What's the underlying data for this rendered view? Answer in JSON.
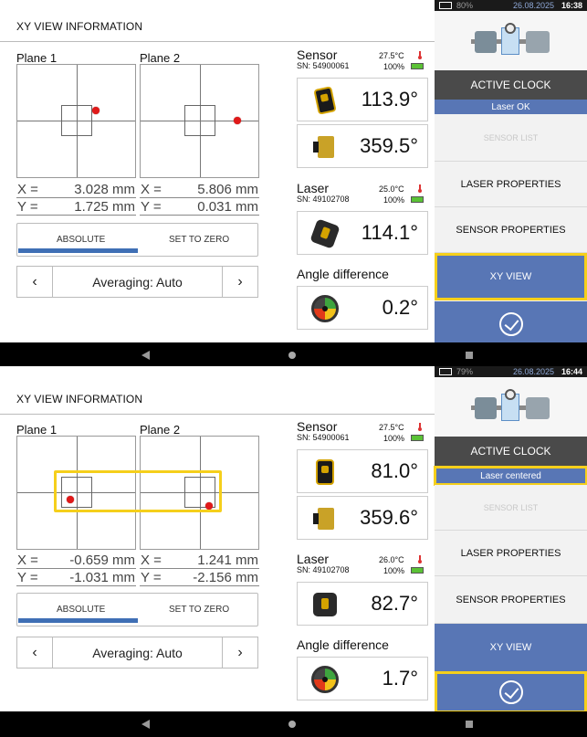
{
  "screens": [
    {
      "title": "XY VIEW INFORMATION",
      "plane1": {
        "label": "Plane 1",
        "x_key": "X =",
        "x_val": "3.028 mm",
        "y_key": "Y =",
        "y_val": "1.725 mm"
      },
      "plane2": {
        "label": "Plane 2",
        "x_key": "X =",
        "x_val": "5.806 mm",
        "y_key": "Y =",
        "y_val": "0.031 mm"
      },
      "mode": {
        "absolute": "ABSOLUTE",
        "set_to_zero": "SET TO ZERO",
        "selected": "ABSOLUTE"
      },
      "averaging": {
        "label": "Averaging: Auto",
        "prev": "‹",
        "next": "›"
      },
      "sensor": {
        "title": "Sensor",
        "sn": "SN: 54900061",
        "temp": "27.5°C",
        "battery": "100%"
      },
      "sensor_reading_1": "113.9°",
      "sensor_reading_2": "359.5°",
      "laser": {
        "title": "Laser",
        "sn": "SN: 49102708",
        "temp": "25.0°C",
        "battery": "100%"
      },
      "laser_reading": "114.1°",
      "angle_difference": {
        "title": "Angle difference",
        "value": "0.2°"
      },
      "status": {
        "battery": "80%",
        "date": "26.08.2025",
        "time": "16:38"
      },
      "menu": {
        "active_clock": "ACTIVE CLOCK",
        "laser_status": "Laser OK",
        "sensor_list": "SENSOR LIST",
        "laser_properties": "LASER PROPERTIES",
        "sensor_properties": "SENSOR PROPERTIES",
        "xy_view": "XY VIEW"
      }
    },
    {
      "title": "XY VIEW INFORMATION",
      "plane1": {
        "label": "Plane 1",
        "x_key": "X =",
        "x_val": "-0.659 mm",
        "y_key": "Y =",
        "y_val": "-1.031 mm"
      },
      "plane2": {
        "label": "Plane 2",
        "x_key": "X =",
        "x_val": "1.241 mm",
        "y_key": "Y =",
        "y_val": "-2.156 mm"
      },
      "mode": {
        "absolute": "ABSOLUTE",
        "set_to_zero": "SET TO ZERO",
        "selected": "ABSOLUTE"
      },
      "averaging": {
        "label": "Averaging: Auto",
        "prev": "‹",
        "next": "›"
      },
      "sensor": {
        "title": "Sensor",
        "sn": "SN: 54900061",
        "temp": "27.5°C",
        "battery": "100%"
      },
      "sensor_reading_1": "81.0°",
      "sensor_reading_2": "359.6°",
      "laser": {
        "title": "Laser",
        "sn": "SN: 49102708",
        "temp": "26.0°C",
        "battery": "100%"
      },
      "laser_reading": "82.7°",
      "angle_difference": {
        "title": "Angle difference",
        "value": "1.7°"
      },
      "status": {
        "battery": "79%",
        "date": "26.08.2025",
        "time": "16:44"
      },
      "menu": {
        "active_clock": "ACTIVE CLOCK",
        "laser_status": "Laser centered",
        "sensor_list": "SENSOR LIST",
        "laser_properties": "LASER PROPERTIES",
        "sensor_properties": "SENSOR PROPERTIES",
        "xy_view": "XY VIEW"
      }
    }
  ],
  "colors": {
    "accent_blue": "#5876b5",
    "highlight_yellow": "#f5cf1b",
    "dot_red": "#e01919",
    "dark_button": "#4a4a4a"
  }
}
